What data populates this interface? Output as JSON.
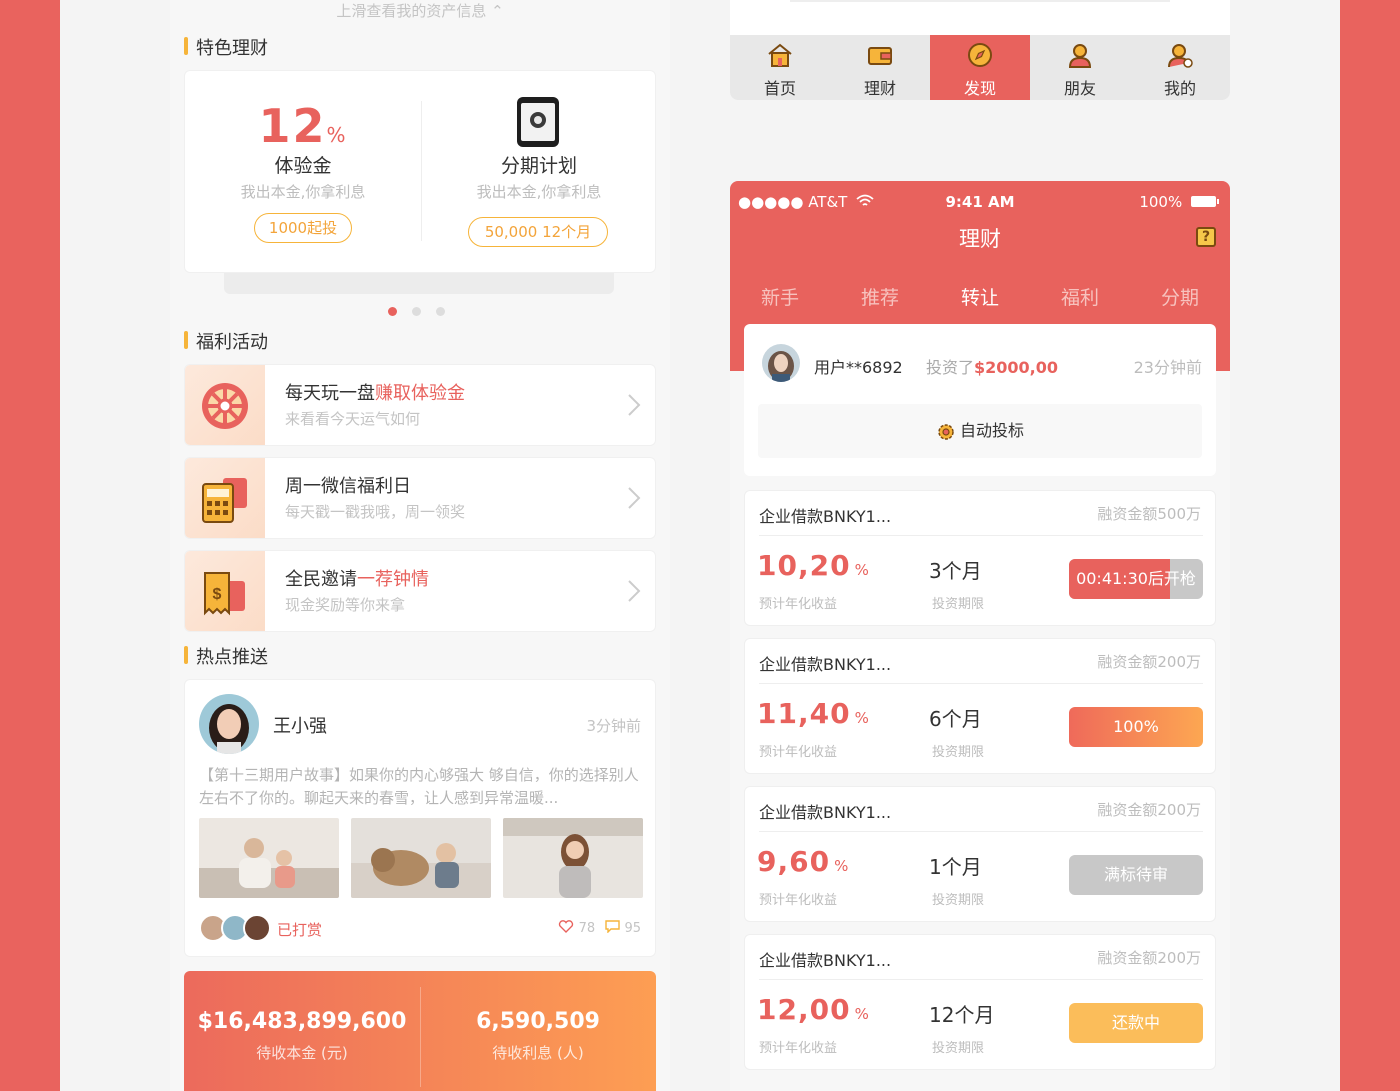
{
  "left": {
    "scroll_hint": "上滑查看我的资产信息 ⌃",
    "featured": {
      "section_title": "特色理财",
      "rate_number": "12",
      "rate_unit": "%",
      "exp_title": "体验金",
      "exp_sub": "我出本金,你拿利息",
      "exp_pill": "1000起投",
      "plan_title": "分期计划",
      "plan_sub": "我出本金,你拿利息",
      "plan_pill": "50,000   12个月"
    },
    "welfare": {
      "section_title": "福利活动",
      "items": [
        {
          "title": "每天玩一盘",
          "highlight": "赚取体验金",
          "sub": "来看看今天运气如何",
          "icon": "wheel-icon"
        },
        {
          "title": "周一微信福利日",
          "highlight": "",
          "sub": "每天戳一戳我哦，周一领奖",
          "icon": "calculator-icon"
        },
        {
          "title": "全民邀请",
          "highlight": "一荐钟情",
          "sub": "现金奖励等你来拿",
          "icon": "receipt-icon"
        }
      ]
    },
    "hot": {
      "section_title": "热点推送",
      "user": "王小强",
      "time": "3分钟前",
      "story": "【第十三期用户故事】如果你的内心够强大 够自信，你的选择别人左右不了你的。聊起天来的春雪，让人感到异常温暖...",
      "tipped": "已打赏",
      "likes": "78",
      "comments": "95"
    },
    "totals": {
      "principal_value": "$16,483,899,600",
      "principal_label": "待收本金 (元)",
      "interest_value": "6,590,509",
      "interest_label": "待收利息 (人)"
    }
  },
  "tabbar": [
    {
      "label": "首页",
      "icon": "home-icon"
    },
    {
      "label": "理财",
      "icon": "wallet-icon"
    },
    {
      "label": "发现",
      "icon": "compass-icon",
      "active": true
    },
    {
      "label": "朋友",
      "icon": "friend-icon"
    },
    {
      "label": "我的",
      "icon": "profile-icon"
    }
  ],
  "right": {
    "status": {
      "carrier": "●●●●● AT&T",
      "time": "9:41 AM",
      "battery": "100%"
    },
    "title": "理财",
    "help_glyph": "?",
    "tabs": [
      "新手",
      "推荐",
      "转让",
      "福利",
      "分期"
    ],
    "active_tab": "转让",
    "feed": {
      "user": "用户**6892",
      "invest_prefix": "投资了",
      "invest_amount": "$2000,00",
      "time": "23分钟前",
      "auto_bid": "自动投标"
    },
    "loans": [
      {
        "name": "企业借款BNKY1...",
        "amount": "融资金额500万",
        "rate": "10,20",
        "rate_unit": "%",
        "rate_label": "预计年化收益",
        "term": "3个月",
        "term_label": "投资期限",
        "button": "00:41:30后开枪",
        "state": "countdown",
        "progress": 0.75
      },
      {
        "name": "企业借款BNKY1...",
        "amount": "融资金额200万",
        "rate": "11,40",
        "rate_unit": "%",
        "rate_label": "预计年化收益",
        "term": "6个月",
        "term_label": "投资期限",
        "button": "100%",
        "state": "progress"
      },
      {
        "name": "企业借款BNKY1...",
        "amount": "融资金额200万",
        "rate": "9,60",
        "rate_unit": "%",
        "rate_label": "预计年化收益",
        "term": "1个月",
        "term_label": "投资期限",
        "button": "满标待审",
        "state": "full"
      },
      {
        "name": "企业借款BNKY1...",
        "amount": "融资金额200万",
        "rate": "12,00",
        "rate_unit": "%",
        "rate_label": "预计年化收益",
        "term": "12个月",
        "term_label": "投资期限",
        "button": "还款中",
        "state": "repaying"
      }
    ]
  },
  "colors": {
    "accent": "#e8625d",
    "orange": "#f6b43a",
    "gray": "#c8c8c8"
  }
}
